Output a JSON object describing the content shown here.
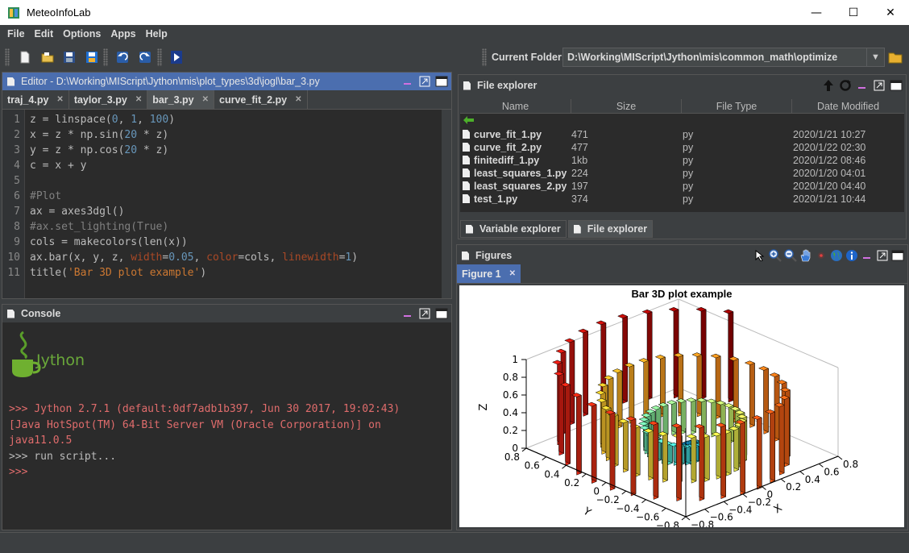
{
  "window": {
    "title": "MeteoInfoLab"
  },
  "menubar": {
    "items": [
      "File",
      "Edit",
      "Options",
      "Apps",
      "Help"
    ]
  },
  "toolbar": {
    "folder_label": "Current Folder:",
    "folder_value": "D:\\Working\\MIScript\\Jython\\mis\\common_math\\optimize"
  },
  "editor": {
    "title": "Editor - D:\\Working\\MIScript\\Jython\\mis\\plot_types\\3d\\jogl\\bar_3.py",
    "tabs": [
      "traj_4.py",
      "taylor_3.py",
      "bar_3.py",
      "curve_fit_2.py"
    ],
    "active_tab": "bar_3.py",
    "lines": [
      "z = linspace(0, 1, 100)",
      "x = z * np.sin(20 * z)",
      "y = z * np.cos(20 * z)",
      "c = x + y",
      "",
      "#Plot",
      "ax = axes3dgl()",
      "#ax.set_lighting(True)",
      "cols = makecolors(len(x))",
      "ax.bar(x, y, z, width=0.05, color=cols, linewidth=1)",
      "title('Bar 3D plot example')"
    ]
  },
  "console": {
    "title": "Console",
    "logo_text": "Jython",
    "lines": [
      ">>> Jython 2.7.1 (default:0df7adb1b397, Jun 30 2017, 19:02:43)",
      "[Java HotSpot(TM) 64-Bit Server VM (Oracle Corporation)] on",
      "java11.0.5",
      ">>> run script...",
      ">>>"
    ]
  },
  "file_explorer": {
    "title": "File explorer",
    "columns": [
      "Name",
      "Size",
      "File Type",
      "Date Modified"
    ],
    "rows": [
      {
        "name": "curve_fit_1.py",
        "size": "471",
        "type": "py",
        "date": "2020/1/21 10:27"
      },
      {
        "name": "curve_fit_2.py",
        "size": "477",
        "type": "py",
        "date": "2020/1/22 02:30"
      },
      {
        "name": "finitediff_1.py",
        "size": "1kb",
        "type": "py",
        "date": "2020/1/22 08:46"
      },
      {
        "name": "least_squares_1.py",
        "size": "224",
        "type": "py",
        "date": "2020/1/20 04:01"
      },
      {
        "name": "least_squares_2.py",
        "size": "197",
        "type": "py",
        "date": "2020/1/20 04:40"
      },
      {
        "name": "test_1.py",
        "size": "374",
        "type": "py",
        "date": "2020/1/21 10:44"
      }
    ],
    "bottom_tabs": [
      "Variable explorer",
      "File explorer"
    ],
    "active_bottom_tab": "File explorer"
  },
  "figures": {
    "title": "Figures",
    "tab": "Figure 1",
    "plot_title": "Bar 3D plot example",
    "z_label": "Z",
    "x_label": "X",
    "y_label": "Y",
    "z_ticks": [
      "0",
      "0.2",
      "0.4",
      "0.6",
      "0.8",
      "1"
    ],
    "x_ticks": [
      "−0.8",
      "−0.6",
      "−0.4",
      "−0.2",
      "0",
      "0.2",
      "0.4",
      "0.6",
      "0.8"
    ],
    "y_ticks": [
      "0.8",
      "0.6",
      "0.4",
      "0.2",
      "0",
      "−0.2",
      "−0.4",
      "−0.6",
      "−0.8"
    ]
  },
  "chart_data": {
    "type": "bar",
    "title": "Bar 3D plot example",
    "xlabel": "X",
    "ylabel": "Y",
    "zlabel": "Z",
    "xlim": [
      -0.8,
      0.8
    ],
    "ylim": [
      -0.8,
      0.8
    ],
    "zlim": [
      0,
      1
    ],
    "grid": false
  },
  "colors": {
    "accent": "#4b6eaf",
    "background": "#3c3f41",
    "editor_bg": "#2b2b2b",
    "console_text": "#e06c6c"
  }
}
